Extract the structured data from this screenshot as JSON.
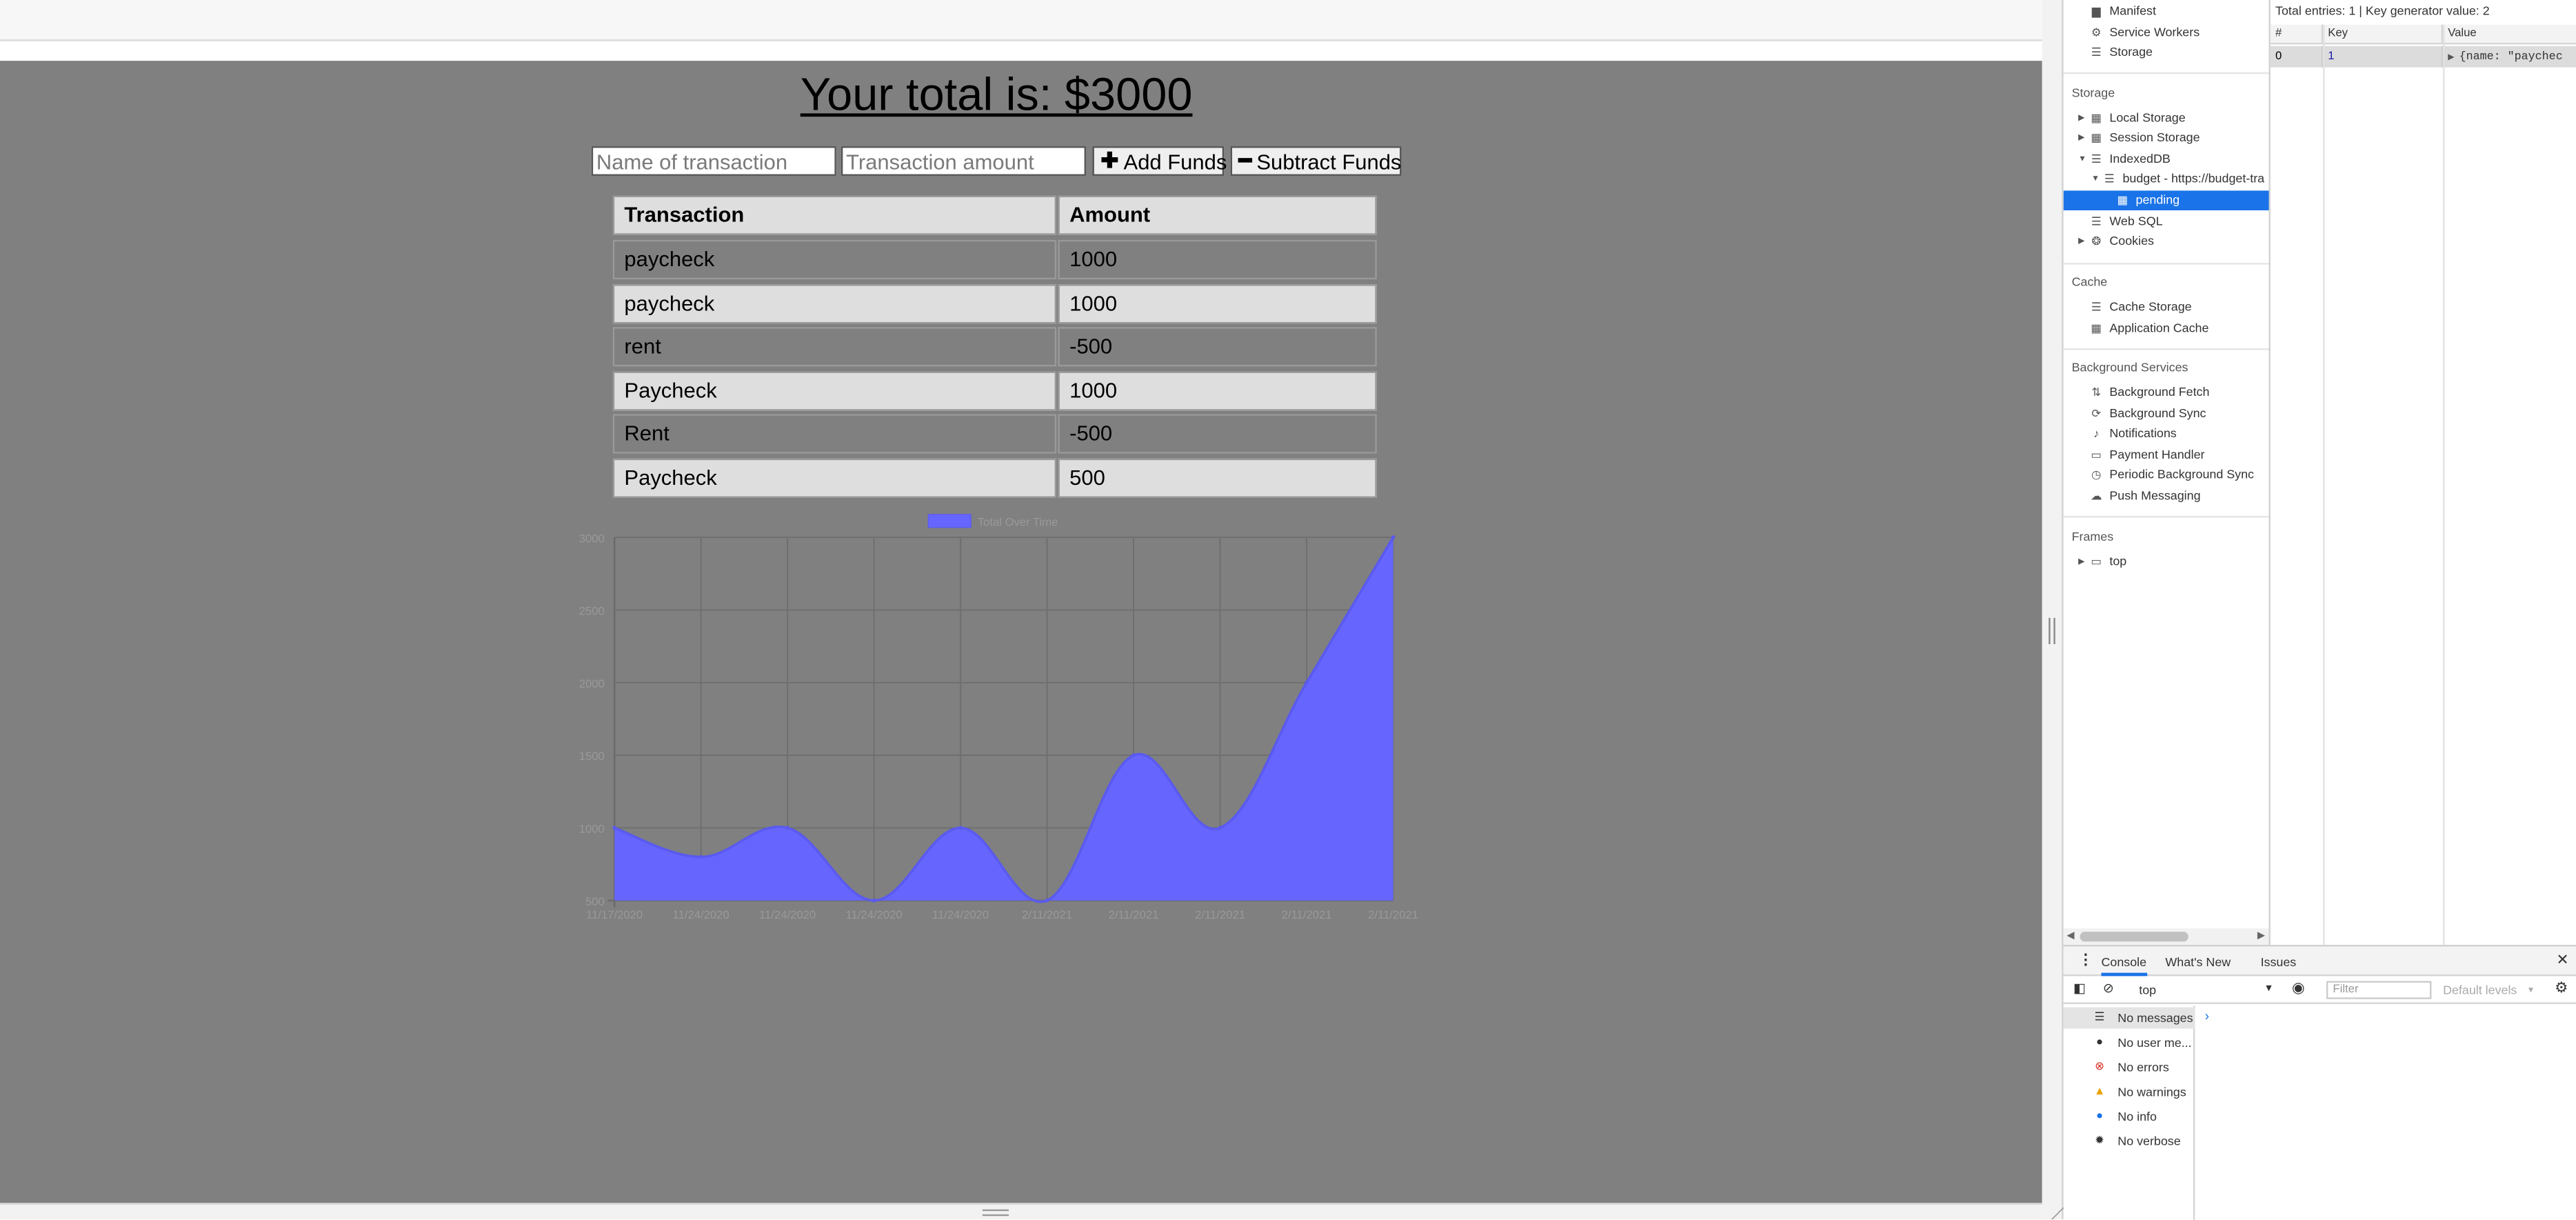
{
  "page": {
    "total_text": "Your total is: $3000",
    "name_placeholder": "Name of transaction",
    "amount_placeholder": "Transaction amount",
    "add_button": "Add Funds",
    "subtract_button": "Subtract Funds",
    "table_headers": [
      "Transaction",
      "Amount"
    ],
    "rows": [
      {
        "name": "paycheck",
        "amount": "1000"
      },
      {
        "name": "paycheck",
        "amount": "1000"
      },
      {
        "name": "rent",
        "amount": "-500"
      },
      {
        "name": "Paycheck",
        "amount": "1000"
      },
      {
        "name": "Rent",
        "amount": "-500"
      },
      {
        "name": "Paycheck",
        "amount": "500"
      }
    ]
  },
  "chart_data": {
    "type": "area",
    "legend": "Total Over Time",
    "x": [
      "11/17/2020",
      "11/24/2020",
      "11/24/2020",
      "11/24/2020",
      "11/24/2020",
      "2/11/2021",
      "2/11/2021",
      "2/11/2021",
      "2/11/2021",
      "2/11/2021"
    ],
    "values": [
      1000,
      800,
      1000,
      500,
      1000,
      500,
      1500,
      1000,
      2000,
      3000
    ],
    "yticks": [
      500,
      1000,
      1500,
      2000,
      2500,
      3000
    ],
    "ylim": [
      500,
      3000
    ],
    "grid": true,
    "fill_color": "#6666ff",
    "line_color": "#5a5aef",
    "tick_color": "#999999"
  },
  "devtools": {
    "sidebar": {
      "app_items": [
        "Manifest",
        "Service Workers",
        "Storage"
      ],
      "storage_title": "Storage",
      "storage_items": [
        "Local Storage",
        "Session Storage",
        "IndexedDB"
      ],
      "db_name": "budget - https://budget-tra",
      "store_name": "pending",
      "storage_items_after": [
        "Web SQL",
        "Cookies"
      ],
      "cache_title": "Cache",
      "cache_items": [
        "Cache Storage",
        "Application Cache"
      ],
      "bg_title": "Background Services",
      "bg_items": [
        "Background Fetch",
        "Background Sync",
        "Notifications",
        "Payment Handler",
        "Periodic Background Sync",
        "Push Messaging"
      ],
      "frames_title": "Frames",
      "frame_item": "top"
    },
    "object_store": {
      "summary": "Total entries: 1 | Key generator value: 2",
      "columns": [
        "#",
        "Key",
        "Value"
      ],
      "row": {
        "index": "0",
        "key": "1",
        "value": "{name: \"paychec"
      }
    },
    "drawer": {
      "tabs": [
        "Console",
        "What's New",
        "Issues"
      ],
      "context": "top",
      "filter_placeholder": "Filter",
      "levels": "Default levels",
      "messages": [
        "No messages",
        "No user me...",
        "No errors",
        "No warnings",
        "No info",
        "No verbose"
      ]
    }
  }
}
